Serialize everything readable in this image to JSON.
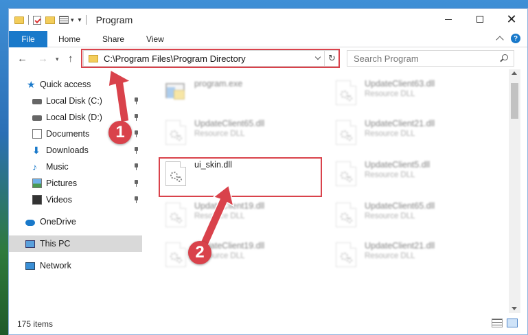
{
  "window": {
    "title": "Program"
  },
  "ribbon": {
    "tabs": [
      "File",
      "Home",
      "Share",
      "View"
    ],
    "help": "?"
  },
  "navbar": {
    "address": "C:\\Program Files\\Program Directory",
    "search_placeholder": "Search Program"
  },
  "sidebar": {
    "items": [
      {
        "label": "Quick access",
        "icon": "star-icon"
      },
      {
        "label": "Local Disk (C:)",
        "icon": "drive-icon",
        "pinned": true
      },
      {
        "label": "Local Disk (D:)",
        "icon": "drive-icon",
        "pinned": true
      },
      {
        "label": "Documents",
        "icon": "documents-icon",
        "pinned": true
      },
      {
        "label": "Downloads",
        "icon": "download-icon",
        "pinned": true
      },
      {
        "label": "Music",
        "icon": "music-icon",
        "pinned": true
      },
      {
        "label": "Pictures",
        "icon": "pictures-icon",
        "pinned": true
      },
      {
        "label": "Videos",
        "icon": "videos-icon",
        "pinned": true
      },
      {
        "label": "OneDrive",
        "icon": "cloud-icon"
      },
      {
        "label": "This PC",
        "icon": "computer-icon",
        "selected": true
      },
      {
        "label": "Network",
        "icon": "network-icon"
      }
    ]
  },
  "files": [
    {
      "name": "program.exe",
      "type": "",
      "kind": "exe"
    },
    {
      "name": "UpdateClient63.dll",
      "type": "Resource DLL",
      "kind": "dll"
    },
    {
      "name": "UpdateClient65.dll",
      "type": "Resource DLL",
      "kind": "dll"
    },
    {
      "name": "UpdateClient21.dll",
      "type": "Resource DLL",
      "kind": "dll"
    },
    {
      "name": "ui_skin.dll",
      "type": "",
      "kind": "dll",
      "highlighted": true
    },
    {
      "name": "UpdateClient5.dll",
      "type": "Resource DLL",
      "kind": "dll"
    },
    {
      "name": "UpdateClient19.dll",
      "type": "Resource DLL",
      "kind": "dll"
    },
    {
      "name": "UpdateClient65.dll",
      "type": "Resource DLL",
      "kind": "dll"
    },
    {
      "name": "UpdateClient19.dll",
      "type": "Resource DLL",
      "kind": "dll"
    },
    {
      "name": "UpdateClient21.dll",
      "type": "Resource DLL",
      "kind": "dll"
    }
  ],
  "status": {
    "count": "175 items"
  },
  "annotations": {
    "step1": "1",
    "step2": "2",
    "color": "#d9424b"
  }
}
